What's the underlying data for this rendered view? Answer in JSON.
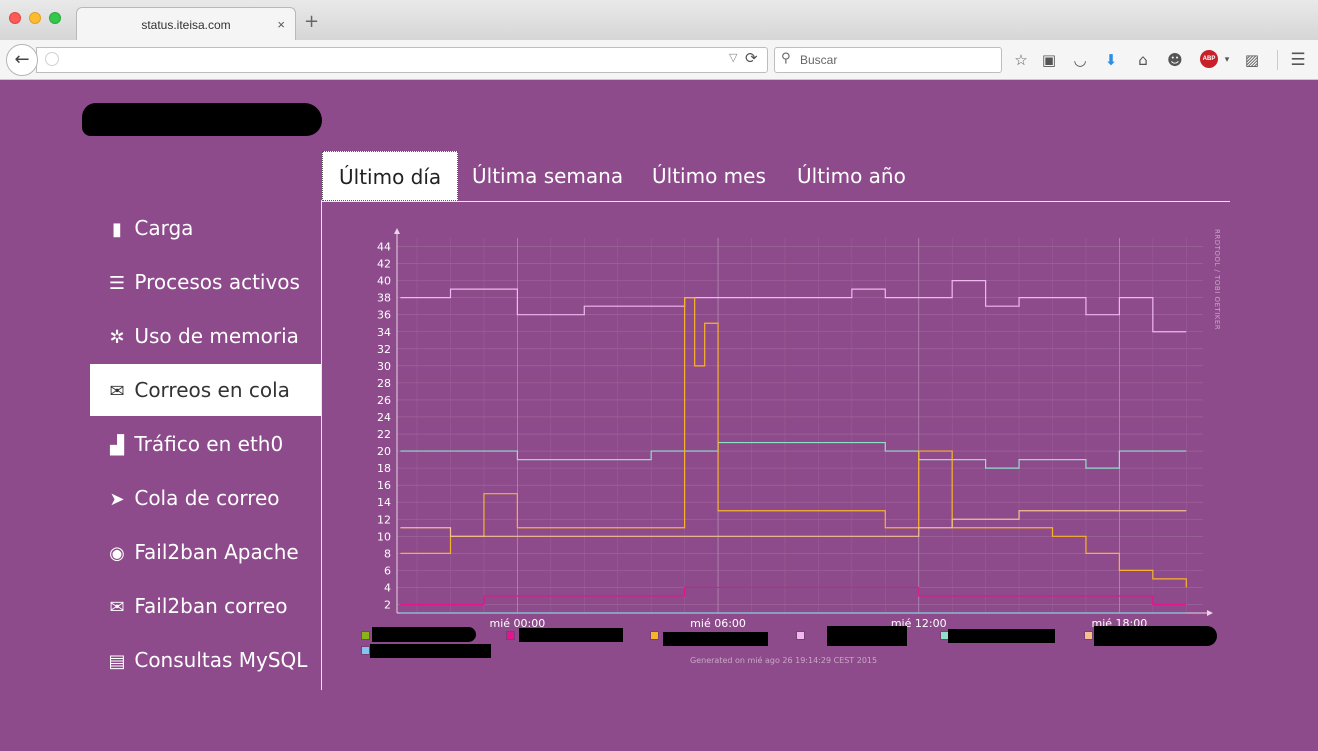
{
  "browser": {
    "tab_title": "status.iteisa.com",
    "tab_close": "×",
    "new_tab": "+",
    "search_placeholder": "Buscar",
    "back_glyph": "←",
    "reload_glyph": "⟳",
    "url_drop_glyph": "▽",
    "search_glyph": "⚲",
    "toolbar_icons": [
      "star-icon",
      "reading-list-icon",
      "pocket-icon",
      "download-icon",
      "home-icon",
      "chat-icon",
      "adblock-icon",
      "selenium-icon",
      "menu-icon"
    ],
    "abp_label": "ABP"
  },
  "tabs": [
    {
      "label": "Último día",
      "active": true
    },
    {
      "label": "Última semana",
      "active": false
    },
    {
      "label": "Último mes",
      "active": false
    },
    {
      "label": "Último año",
      "active": false
    }
  ],
  "sidebar": {
    "items": [
      {
        "label": "Carga",
        "icon": "bar-chart-icon",
        "glyph": "▮",
        "active": false
      },
      {
        "label": "Procesos activos",
        "icon": "list-icon",
        "glyph": "☰",
        "active": false
      },
      {
        "label": "Uso de memoria",
        "icon": "gear-icon",
        "glyph": "✲",
        "active": false
      },
      {
        "label": "Correos en cola",
        "icon": "envelope-icon",
        "glyph": "✉",
        "active": true
      },
      {
        "label": "Tráfico en eth0",
        "icon": "signal-icon",
        "glyph": "▟",
        "active": false
      },
      {
        "label": "Cola de correo",
        "icon": "send-icon",
        "glyph": "➤",
        "active": false
      },
      {
        "label": "Fail2ban Apache",
        "icon": "eye-icon",
        "glyph": "◉",
        "active": false
      },
      {
        "label": "Fail2ban correo",
        "icon": "envelope-icon",
        "glyph": "✉",
        "active": false
      },
      {
        "label": "Consultas MySQL",
        "icon": "table-icon",
        "glyph": "▤",
        "active": false
      }
    ]
  },
  "colors": {
    "background": "#8e4b8b",
    "series_pink": "#f0b8ef",
    "series_teal": "#8fe0c9",
    "series_yellow": "#f7b42a",
    "series_peach": "#f3c08e",
    "series_magenta": "#e3148c",
    "series_green": "#8ab31a",
    "series_lightblue": "#86c3ee"
  },
  "chart_data": {
    "type": "line",
    "y_ticks": [
      2,
      4,
      6,
      8,
      10,
      12,
      14,
      16,
      18,
      20,
      22,
      24,
      26,
      28,
      30,
      32,
      34,
      36,
      38,
      40,
      42,
      44
    ],
    "ylim": [
      1,
      45
    ],
    "x_ticks": [
      "mié 00:00",
      "mié 06:00",
      "mié 12:00",
      "mié 18:00"
    ],
    "x": [
      -3.5,
      -2,
      -1,
      0,
      2,
      4,
      5,
      5.3,
      5.6,
      6,
      8,
      10,
      11,
      12,
      13,
      14,
      15,
      16,
      17,
      18,
      19,
      20
    ],
    "series": [
      {
        "color": "#f0b8ef",
        "values": [
          38,
          39,
          39,
          36,
          37,
          37,
          38,
          38,
          38,
          38,
          38,
          39,
          38,
          38,
          40,
          37,
          38,
          38,
          36,
          38,
          34,
          34
        ]
      },
      {
        "color": "#8fe0c9",
        "values": [
          20,
          20,
          20,
          19,
          19,
          20,
          20,
          20,
          20,
          21,
          21,
          21,
          20,
          19,
          19,
          18,
          19,
          19,
          18,
          20,
          20,
          20
        ]
      },
      {
        "color": "#f7b42a",
        "values": [
          8,
          10,
          15,
          11,
          11,
          11,
          38,
          30,
          35,
          13,
          13,
          13,
          11,
          20,
          11,
          11,
          11,
          10,
          8,
          6,
          5,
          4
        ]
      },
      {
        "color": "#f3c08e",
        "values": [
          11,
          10,
          10,
          10,
          10,
          10,
          10,
          10,
          10,
          10,
          10,
          10,
          10,
          11,
          12,
          12,
          13,
          13,
          13,
          13,
          13,
          13
        ]
      },
      {
        "color": "#e3148c",
        "values": [
          2,
          2,
          3,
          3,
          3,
          3,
          4,
          4,
          4,
          4,
          4,
          4,
          4,
          3,
          3,
          3,
          3,
          3,
          3,
          3,
          2,
          2
        ]
      },
      {
        "color": "#8ab31a",
        "values": [
          0,
          0,
          0,
          0,
          0,
          0,
          0,
          0,
          0,
          0,
          0,
          0,
          0,
          0,
          0,
          0,
          0,
          0,
          0,
          0,
          0,
          0
        ]
      },
      {
        "color": "#86c3ee",
        "values": [
          0,
          0,
          0,
          0,
          0,
          0,
          0,
          0,
          0,
          0,
          0,
          0,
          0,
          0,
          0,
          0,
          0,
          0,
          0,
          0,
          0,
          0
        ]
      }
    ],
    "legend_colors": [
      "#8ab31a",
      "#e3148c",
      "#f7b42a",
      "#f0b8ef",
      "#8fe0c9",
      "#f3c08e",
      "#86c3ee"
    ],
    "legend_placement": "bottom",
    "grid": true,
    "watermark": "RRDTOOL / TOBI OETIKER",
    "generated": "Generated on mié ago 26 19:14:29 CEST 2015"
  }
}
